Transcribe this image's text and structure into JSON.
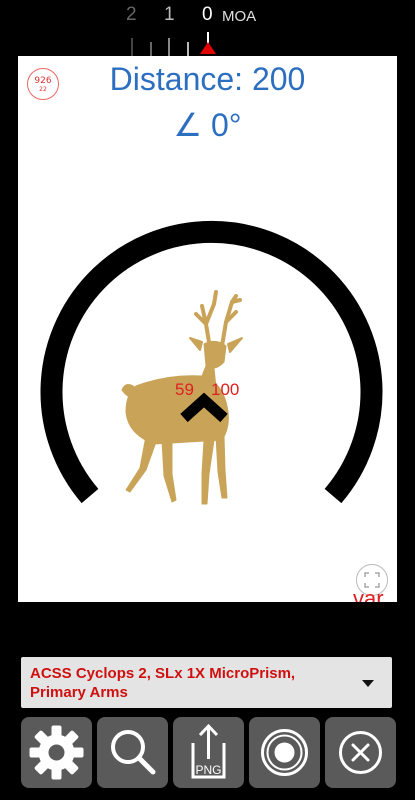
{
  "ruler": {
    "labels": [
      "2",
      "1",
      "0"
    ],
    "unit": "MOA"
  },
  "view": {
    "badge": {
      "line1": "926",
      "line2": "22"
    },
    "distance": "Distance: 200",
    "angle": "∠ 0°",
    "target_labels": [
      "59",
      "100"
    ],
    "cut_text": "var",
    "colors": {
      "distance_text": "#2c6fc1",
      "deer": "#c9a458",
      "reticle": "#000000",
      "labels": "#e02020"
    }
  },
  "dropdown": {
    "selected": "ACSS Cyclops 2, SLx 1X MicroPrism, Primary Arms"
  },
  "toolbar": {
    "buttons": [
      {
        "icon": "gear-icon"
      },
      {
        "icon": "search-icon"
      },
      {
        "icon": "png-export-icon",
        "label": "PNG"
      },
      {
        "icon": "record-icon"
      },
      {
        "icon": "close-icon"
      }
    ]
  }
}
